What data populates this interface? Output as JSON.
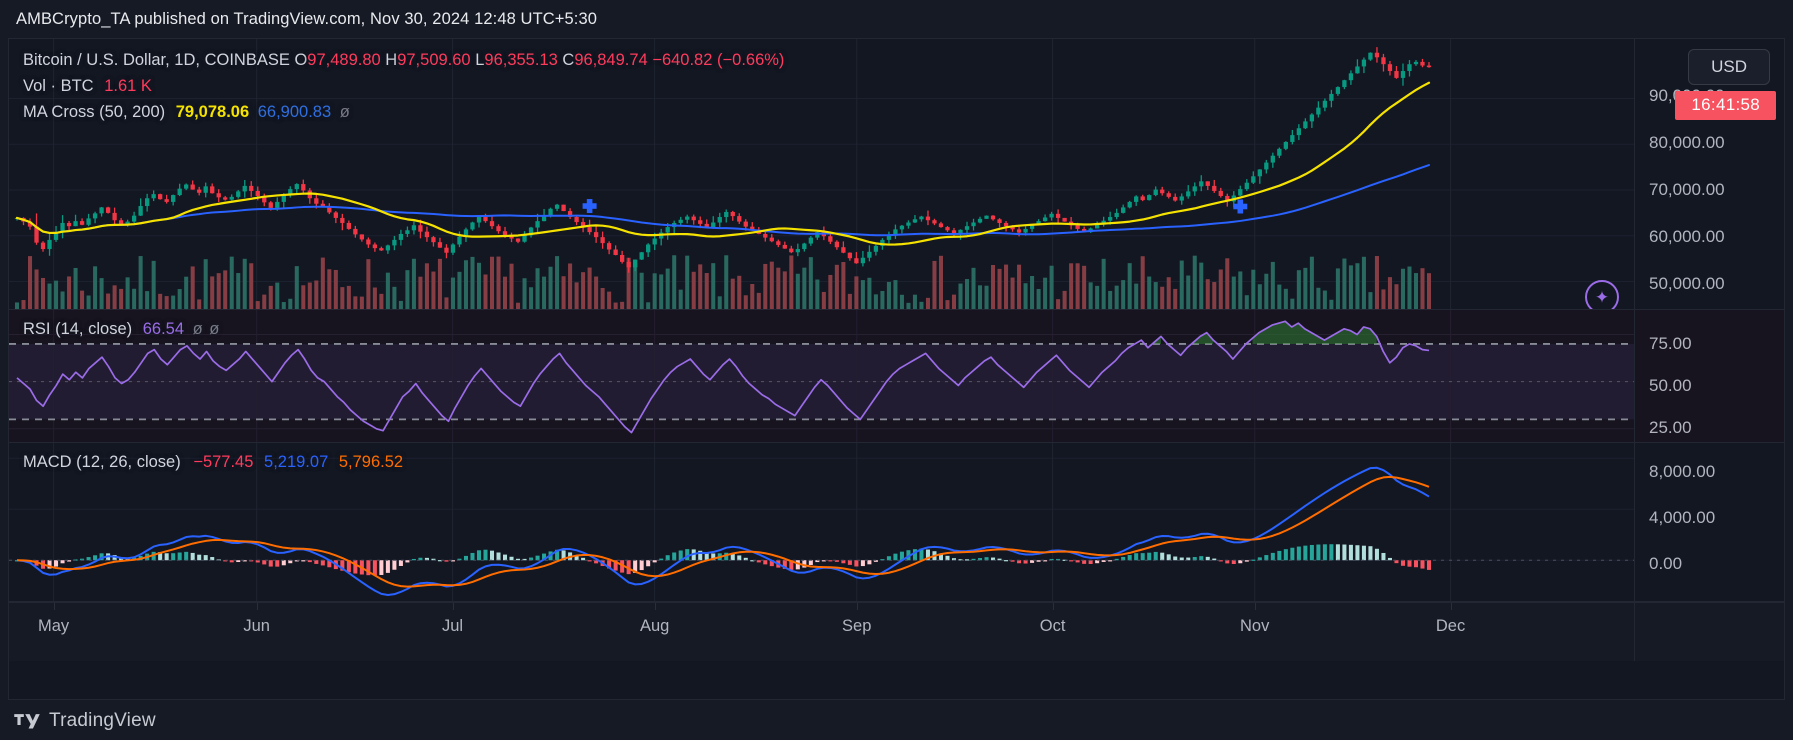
{
  "attribution": {
    "text": "AMBCrypto_TA published on TradingView.com, Nov 30, 2024 12:48 UTC+5:30",
    "author": "AMBCrypto_TA",
    "site": "TradingView.com",
    "datetime": "Nov 30, 2024 12:48 UTC+5:30"
  },
  "symbol_legend": {
    "title": "Bitcoin / U.S. Dollar, 1D, COINBASE",
    "open_label": "O",
    "open": "97,489.80",
    "high_label": "H",
    "high": "97,509.60",
    "low_label": "L",
    "low": "96,355.13",
    "close_label": "C",
    "close": "96,849.74",
    "change": "−640.82",
    "change_pct": "(−0.66%)"
  },
  "volume_legend": {
    "title": "Vol · BTC",
    "value": "1.61 K"
  },
  "ma_legend": {
    "title": "MA Cross (50, 200)",
    "fast": "79,078.06",
    "slow": "66,900.83",
    "extra": "ø"
  },
  "rsi_legend": {
    "title": "RSI (14, close)",
    "value": "66.54",
    "extra1": "ø",
    "extra2": "ø"
  },
  "macd_legend": {
    "title": "MACD (12, 26, close)",
    "hist": "−577.45",
    "macd": "5,219.07",
    "signal": "5,796.52"
  },
  "badges": {
    "currency": "USD",
    "clock": "16:41:58",
    "ai_icon": "sparkle-icon"
  },
  "colors": {
    "background": "#131722",
    "pane_rsi_background": "#17141f",
    "candle_up": "#089981",
    "candle_down": "#f23645",
    "ma_fast": "#f5e200",
    "ma_slow": "#2962ff",
    "rsi_line": "#9b6ce8",
    "macd_line": "#2962ff",
    "signal_line": "#ff6d00",
    "text": "#d1d4dc",
    "axis_text": "#b2b5be",
    "grid": "#1f2430",
    "badge_red": "#f7525f",
    "accent_purple": "#9b6ce8"
  },
  "footer": {
    "logo_name": "tradingview-logo",
    "brand": "TradingView"
  },
  "chart_data": {
    "type": "line",
    "title": "Bitcoin / U.S. Dollar, 1D, COINBASE",
    "xlabel": "",
    "ylabel": "USD",
    "panes": [
      {
        "name": "price",
        "type": "candlestick",
        "ylim": [
          44000,
          103000
        ],
        "yticks": [
          50000,
          60000,
          70000,
          80000,
          90000
        ],
        "ytick_labels": [
          "50,000.00",
          "60,000.00",
          "70,000.00",
          "80,000.00",
          "90,000.00"
        ],
        "grid": true,
        "overlays": [
          {
            "name": "MA 50",
            "color": "#f5e200",
            "last_value": 79078.06
          },
          {
            "name": "MA 200",
            "color": "#2962ff",
            "last_value": 66900.83
          }
        ],
        "markers": [
          {
            "type": "cross",
            "label": "death-cross",
            "x_index": 88,
            "y_value": 66500,
            "color": "#2962ff"
          },
          {
            "type": "cross",
            "label": "golden-cross",
            "x_index": 188,
            "y_value": 66400,
            "color": "#2962ff"
          }
        ],
        "ohlc_last": {
          "o": 97489.8,
          "h": 97509.6,
          "l": 96355.13,
          "c": 96849.74
        },
        "closes": [
          63900,
          63100,
          62000,
          58500,
          57100,
          59100,
          60700,
          62800,
          62100,
          63200,
          62400,
          63800,
          64900,
          66200,
          65000,
          63400,
          62500,
          63100,
          64400,
          66500,
          68200,
          69100,
          68000,
          67400,
          68900,
          70300,
          71200,
          70100,
          69400,
          70800,
          69300,
          68400,
          67900,
          68500,
          69700,
          70900,
          69800,
          68700,
          67300,
          66100,
          67400,
          68900,
          70200,
          71300,
          69900,
          68200,
          67000,
          66400,
          65100,
          63900,
          62800,
          61500,
          60300,
          59200,
          58100,
          57300,
          56800,
          57900,
          59100,
          60400,
          61200,
          62300,
          60900,
          59700,
          58600,
          57400,
          56300,
          58100,
          59800,
          61400,
          62900,
          64100,
          63200,
          62100,
          61000,
          60200,
          59400,
          58700,
          60100,
          61800,
          63200,
          64500,
          65900,
          66800,
          65400,
          64100,
          63000,
          61900,
          60800,
          59700,
          58400,
          57000,
          55800,
          54300,
          53100,
          54800,
          56400,
          58100,
          59400,
          60700,
          61900,
          62800,
          63500,
          64200,
          63400,
          62600,
          61800,
          62900,
          64100,
          65200,
          64300,
          63100,
          62000,
          61200,
          60400,
          59600,
          58800,
          58000,
          57200,
          56400,
          57100,
          58300,
          59600,
          60800,
          59900,
          58700,
          57500,
          56300,
          55100,
          54000,
          55200,
          56500,
          57800,
          59100,
          60300,
          61400,
          62200,
          62900,
          63600,
          64200,
          63400,
          62700,
          61900,
          61200,
          60500,
          61300,
          62100,
          62900,
          63700,
          64400,
          63600,
          62800,
          62100,
          61400,
          60700,
          61500,
          62400,
          63200,
          64000,
          64800,
          63900,
          63100,
          62300,
          61500,
          60800,
          61600,
          62500,
          63300,
          64100,
          65000,
          66200,
          67400,
          68600,
          67800,
          68900,
          70100,
          69300,
          68500,
          67700,
          68600,
          69700,
          70800,
          71900,
          70900,
          69800,
          68700,
          67500,
          68800,
          70200,
          71600,
          73000,
          74500,
          76000,
          77500,
          79000,
          80500,
          82000,
          83500,
          85000,
          86500,
          88000,
          89500,
          91000,
          92500,
          94000,
          95500,
          97000,
          98500,
          100000,
          99000,
          97500,
          96000,
          94500,
          96000,
          97500,
          98000,
          97200,
          96849
        ]
      },
      {
        "name": "rsi",
        "type": "line",
        "indicator": "RSI (14, close)",
        "ylim": [
          18,
          88
        ],
        "yticks": [
          25,
          50,
          75
        ],
        "ytick_labels": [
          "25.00",
          "50.00",
          "75.00"
        ],
        "bands": {
          "overbought": 70,
          "oversold": 30,
          "midline": 50
        },
        "last_value": 66.54,
        "color": "#9b6ce8",
        "values": [
          52,
          49,
          46,
          40,
          37,
          43,
          48,
          54,
          51,
          55,
          52,
          57,
          60,
          63,
          58,
          52,
          49,
          51,
          55,
          60,
          65,
          67,
          62,
          59,
          63,
          67,
          69,
          65,
          62,
          66,
          61,
          58,
          56,
          59,
          62,
          66,
          62,
          58,
          54,
          50,
          55,
          60,
          64,
          67,
          62,
          56,
          52,
          50,
          46,
          42,
          39,
          35,
          32,
          29,
          27,
          25,
          24,
          30,
          36,
          42,
          45,
          49,
          44,
          40,
          36,
          32,
          29,
          36,
          42,
          48,
          53,
          57,
          53,
          49,
          45,
          42,
          39,
          37,
          43,
          49,
          54,
          58,
          62,
          65,
          60,
          56,
          52,
          48,
          45,
          42,
          38,
          34,
          30,
          26,
          23,
          29,
          35,
          41,
          46,
          51,
          55,
          58,
          60,
          62,
          58,
          54,
          51,
          55,
          59,
          62,
          58,
          53,
          49,
          46,
          43,
          41,
          38,
          36,
          34,
          32,
          37,
          42,
          47,
          51,
          48,
          44,
          40,
          36,
          33,
          30,
          35,
          40,
          45,
          50,
          54,
          57,
          59,
          61,
          63,
          65,
          61,
          57,
          54,
          51,
          48,
          52,
          55,
          58,
          61,
          63,
          59,
          56,
          53,
          50,
          47,
          51,
          55,
          58,
          61,
          64,
          60,
          56,
          53,
          50,
          47,
          51,
          55,
          58,
          61,
          65,
          68,
          70,
          72,
          68,
          71,
          74,
          70,
          67,
          64,
          68,
          71,
          74,
          76,
          72,
          69,
          66,
          62,
          66,
          70,
          73,
          76,
          78,
          80,
          81,
          82,
          79,
          81,
          78,
          76,
          74,
          72,
          74,
          76,
          78,
          77,
          75,
          79,
          78,
          74,
          66,
          60,
          63,
          68,
          70,
          69,
          67,
          66.54
        ]
      },
      {
        "name": "macd",
        "type": "line+histogram",
        "indicator": "MACD (12, 26, close)",
        "ylim": [
          -3200,
          9200
        ],
        "yticks": [
          0,
          4000,
          8000
        ],
        "ytick_labels": [
          "0.00",
          "4,000.00",
          "8,000.00"
        ],
        "series": [
          {
            "name": "MACD",
            "color": "#2962ff",
            "last_value": 5219.07
          },
          {
            "name": "Signal",
            "color": "#ff6d00",
            "last_value": 5796.52
          },
          {
            "name": "Histogram",
            "last_value": -577.45
          }
        ]
      }
    ],
    "x_tick_labels": [
      "May",
      "Jun",
      "Jul",
      "Aug",
      "Sep",
      "Oct",
      "Nov",
      "Dec"
    ],
    "x_tick_positions": [
      43,
      239,
      428,
      623,
      818,
      1007,
      1202,
      1391
    ]
  }
}
